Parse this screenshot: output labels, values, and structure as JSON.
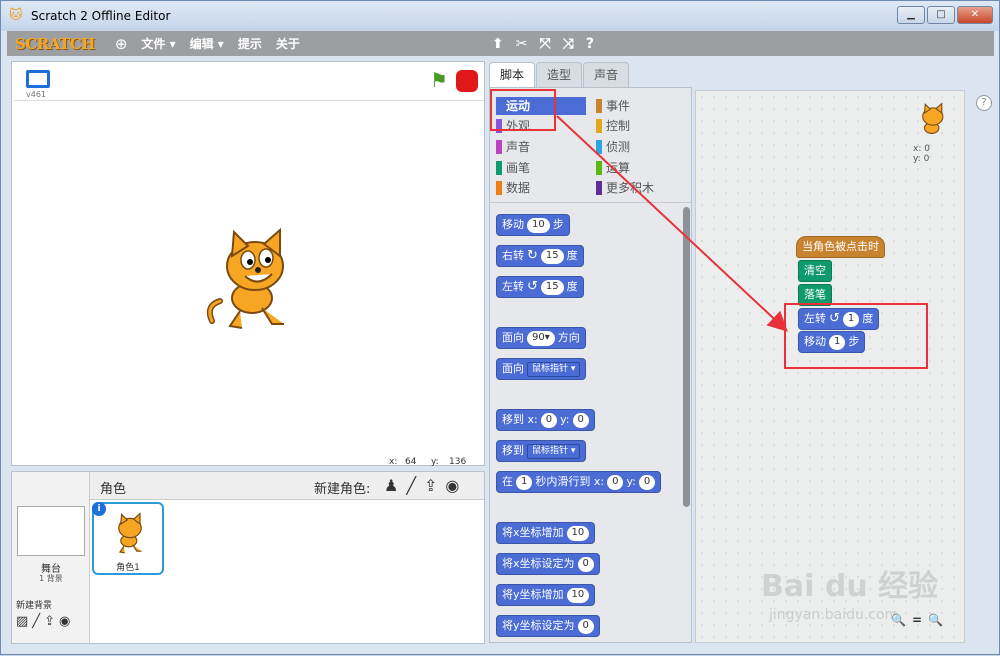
{
  "window": {
    "title": "Scratch 2 Offline Editor",
    "min": "▁",
    "max": "□",
    "close": "✕"
  },
  "menubar": {
    "logo": "SCRATCH",
    "items": [
      "文件 ▾",
      "编辑 ▾",
      "提示",
      "关于"
    ]
  },
  "stage": {
    "version": "v461",
    "x_label": "x:",
    "x_value": "64",
    "y_label": "y:",
    "y_value": "136"
  },
  "sprites": {
    "title": "角色",
    "new_sprite": "新建角色:",
    "stage_label": "舞台",
    "stage_bg_count": "1 背景",
    "new_bg": "新建背景",
    "sprite_name": "角色1"
  },
  "tabs": [
    "脚本",
    "造型",
    "声音"
  ],
  "categories": {
    "left": [
      {
        "label": "运动",
        "color": "#4a6cd4"
      },
      {
        "label": "外观",
        "color": "#8a55d7"
      },
      {
        "label": "声音",
        "color": "#bb42c3"
      },
      {
        "label": "画笔",
        "color": "#0e9a6c"
      },
      {
        "label": "数据",
        "color": "#ee7d16"
      }
    ],
    "right": [
      {
        "label": "事件",
        "color": "#c88330"
      },
      {
        "label": "控制",
        "color": "#e1a91a"
      },
      {
        "label": "侦测",
        "color": "#2ca5e2"
      },
      {
        "label": "运算",
        "color": "#5cb712"
      },
      {
        "label": "更多积木",
        "color": "#632d99"
      }
    ]
  },
  "blocks": {
    "move": {
      "label": "移动",
      "value": "10",
      "suffix": "步"
    },
    "turn_right": {
      "label": "右转",
      "value": "15",
      "suffix": "度"
    },
    "turn_left": {
      "label": "左转",
      "value": "15",
      "suffix": "度"
    },
    "point_direction": {
      "label": "面向",
      "value": "90▾",
      "suffix": "方向"
    },
    "point_towards": {
      "label": "面向",
      "value": "鼠标指针 ▾"
    },
    "goto_xy": {
      "label": "移到 x:",
      "x": "0",
      "ylabel": "y:",
      "y": "0"
    },
    "goto": {
      "label": "移到",
      "value": "鼠标指针 ▾"
    },
    "glide": {
      "prefix": "在",
      "secs": "1",
      "label": "秒内滑行到 x:",
      "x": "0",
      "ylabel": "y:",
      "y": "0"
    },
    "change_x": {
      "label": "将x坐标增加",
      "value": "10"
    },
    "set_x": {
      "label": "将x坐标设定为",
      "value": "0"
    },
    "change_y": {
      "label": "将y坐标增加",
      "value": "10"
    },
    "set_y": {
      "label": "将y坐标设定为",
      "value": "0"
    }
  },
  "script": {
    "sprite_x": "x: 0",
    "sprite_y": "y: 0",
    "hat": "当角色被点击时",
    "clear": "清空",
    "pen_down": "落笔",
    "turn_left": {
      "label": "左转",
      "value": "1",
      "suffix": "度"
    },
    "move": {
      "label": "移动",
      "value": "1",
      "suffix": "步"
    }
  },
  "zoom": {
    "out": "🔍",
    "reset": "=",
    "in": "🔍"
  },
  "watermark": {
    "brand": "Bai du 经验",
    "url": "jingyan.baidu.com"
  }
}
